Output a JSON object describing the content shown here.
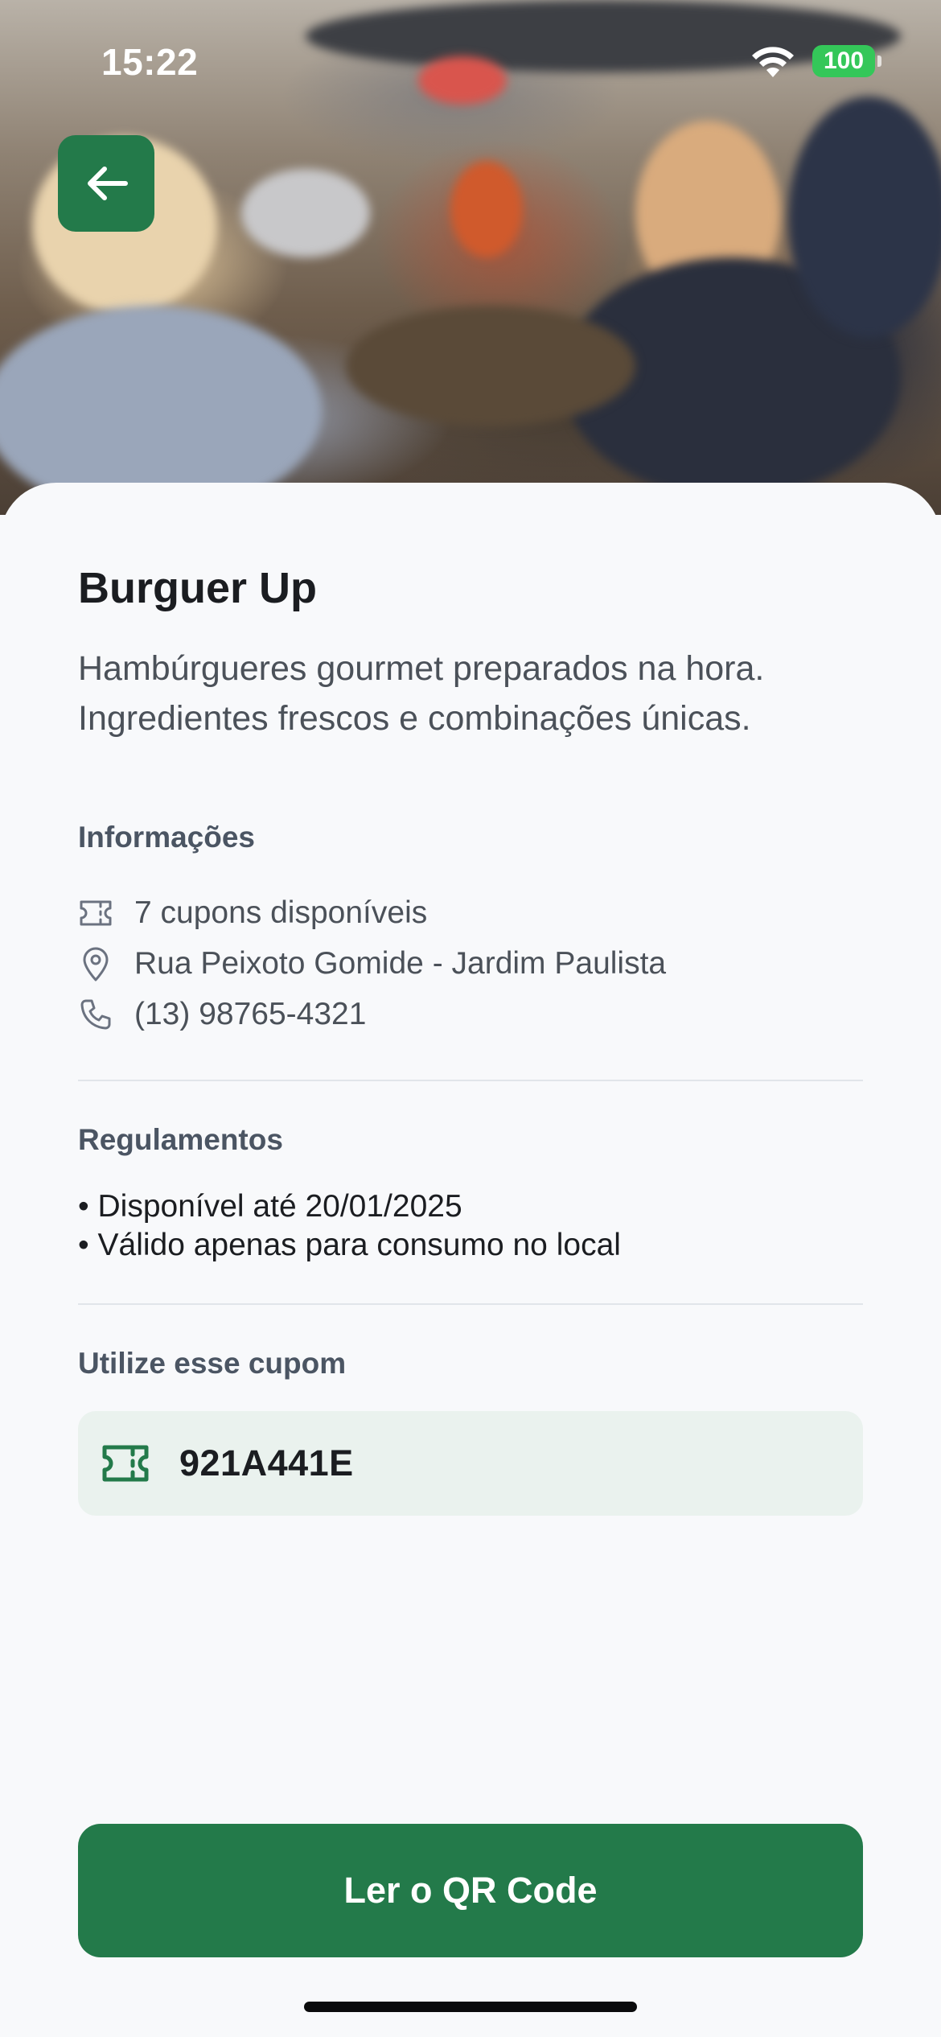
{
  "status_bar": {
    "time": "15:22",
    "battery": "100"
  },
  "header": {
    "back_icon": "arrow-left-icon"
  },
  "place": {
    "name": "Burguer Up",
    "description": "Hambúrgueres gourmet preparados na hora. Ingredientes frescos e combinações únicas."
  },
  "info": {
    "title": "Informações",
    "items": [
      {
        "icon": "ticket-icon",
        "text": "7 cupons disponíveis"
      },
      {
        "icon": "map-pin-icon",
        "text": "Rua Peixoto Gomide - Jardim Paulista"
      },
      {
        "icon": "phone-icon",
        "text": "(13) 98765-4321"
      }
    ]
  },
  "rules": {
    "title": "Regulamentos",
    "items": [
      "• Disponível até 20/01/2025",
      "• Válido apenas para consumo no local"
    ]
  },
  "coupon": {
    "title": "Utilize esse cupom",
    "icon": "ticket-icon",
    "code": "921A441E"
  },
  "actions": {
    "scan_label": "Ler o QR Code"
  },
  "colors": {
    "primary": "#237a4a",
    "coupon_bg": "#eaf2ee",
    "battery": "#34c759"
  }
}
